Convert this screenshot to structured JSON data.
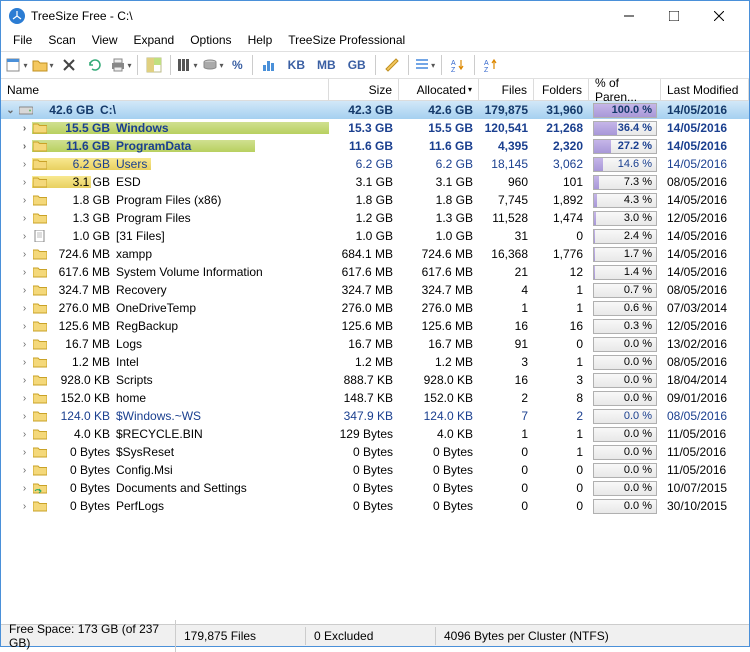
{
  "window": {
    "title": "TreeSize Free - C:\\"
  },
  "menu": [
    "File",
    "Scan",
    "View",
    "Expand",
    "Options",
    "Help",
    "TreeSize Professional"
  ],
  "toolbar": {
    "kb": "KB",
    "mb": "MB",
    "gb": "GB",
    "pct": "%"
  },
  "columns": {
    "name": "Name",
    "size": "Size",
    "alloc": "Allocated",
    "files": "Files",
    "folders": "Folders",
    "pct": "% of Paren...",
    "mod": "Last Modified"
  },
  "root": {
    "sizelabel": "42.6 GB",
    "name": "C:\\",
    "size": "42.3 GB",
    "alloc": "42.6 GB",
    "files": "179,875",
    "folders": "31,960",
    "pct": "100.0 %",
    "mod": "14/05/2016"
  },
  "rows": [
    {
      "indent": 1,
      "szw": 60,
      "sb": "green",
      "sbw": 100,
      "sizelabel": "15.5 GB",
      "name": "Windows",
      "size": "15.3 GB",
      "alloc": "15.5 GB",
      "files": "120,541",
      "folders": "21,268",
      "pct": "36.4 %",
      "pw": 36.4,
      "mod": "14/05/2016",
      "blue": true,
      "bold": true
    },
    {
      "indent": 1,
      "szw": 60,
      "sb": "green",
      "sbw": 75,
      "sizelabel": "11.6 GB",
      "name": "ProgramData",
      "size": "11.6 GB",
      "alloc": "11.6 GB",
      "files": "4,395",
      "folders": "2,320",
      "pct": "27.2 %",
      "pw": 27.2,
      "mod": "14/05/2016",
      "blue": true,
      "bold": true
    },
    {
      "indent": 1,
      "szw": 60,
      "sb": "yellow",
      "sbw": 40,
      "sizelabel": "6.2 GB",
      "name": "Users",
      "size": "6.2 GB",
      "alloc": "6.2 GB",
      "files": "18,145",
      "folders": "3,062",
      "pct": "14.6 %",
      "pw": 14.6,
      "mod": "14/05/2016",
      "blue": true
    },
    {
      "indent": 1,
      "szw": 60,
      "sb": "yellow",
      "sbw": 20,
      "sizelabel": "3.1 GB",
      "name": "ESD",
      "size": "3.1 GB",
      "alloc": "3.1 GB",
      "files": "960",
      "folders": "101",
      "pct": "7.3 %",
      "pw": 7.3,
      "mod": "08/05/2016"
    },
    {
      "indent": 1,
      "szw": 60,
      "sizelabel": "1.8 GB",
      "name": "Program Files (x86)",
      "size": "1.8 GB",
      "alloc": "1.8 GB",
      "files": "7,745",
      "folders": "1,892",
      "pct": "4.3 %",
      "pw": 4.3,
      "mod": "14/05/2016"
    },
    {
      "indent": 1,
      "szw": 60,
      "sizelabel": "1.3 GB",
      "name": "Program Files",
      "size": "1.2 GB",
      "alloc": "1.3 GB",
      "files": "11,528",
      "folders": "1,474",
      "pct": "3.0 %",
      "pw": 3.0,
      "mod": "12/05/2016"
    },
    {
      "indent": 1,
      "szw": 60,
      "sizelabel": "1.0 GB",
      "name": "[31 Files]",
      "size": "1.0 GB",
      "alloc": "1.0 GB",
      "files": "31",
      "folders": "0",
      "pct": "2.4 %",
      "pw": 2.4,
      "mod": "14/05/2016",
      "file": true
    },
    {
      "indent": 1,
      "szw": 60,
      "sizelabel": "724.6 MB",
      "name": "xampp",
      "size": "684.1 MB",
      "alloc": "724.6 MB",
      "files": "16,368",
      "folders": "1,776",
      "pct": "1.7 %",
      "pw": 1.7,
      "mod": "14/05/2016"
    },
    {
      "indent": 1,
      "szw": 60,
      "sizelabel": "617.6 MB",
      "name": "System Volume Information",
      "size": "617.6 MB",
      "alloc": "617.6 MB",
      "files": "21",
      "folders": "12",
      "pct": "1.4 %",
      "pw": 1.4,
      "mod": "14/05/2016"
    },
    {
      "indent": 1,
      "szw": 60,
      "sizelabel": "324.7 MB",
      "name": "Recovery",
      "size": "324.7 MB",
      "alloc": "324.7 MB",
      "files": "4",
      "folders": "1",
      "pct": "0.7 %",
      "pw": 0.7,
      "mod": "08/05/2016"
    },
    {
      "indent": 1,
      "szw": 60,
      "sizelabel": "276.0 MB",
      "name": "OneDriveTemp",
      "size": "276.0 MB",
      "alloc": "276.0 MB",
      "files": "1",
      "folders": "1",
      "pct": "0.6 %",
      "pw": 0.6,
      "mod": "07/03/2014"
    },
    {
      "indent": 1,
      "szw": 60,
      "sizelabel": "125.6 MB",
      "name": "RegBackup",
      "size": "125.6 MB",
      "alloc": "125.6 MB",
      "files": "16",
      "folders": "16",
      "pct": "0.3 %",
      "pw": 0.3,
      "mod": "12/05/2016"
    },
    {
      "indent": 1,
      "szw": 60,
      "sizelabel": "16.7 MB",
      "name": "Logs",
      "size": "16.7 MB",
      "alloc": "16.7 MB",
      "files": "91",
      "folders": "0",
      "pct": "0.0 %",
      "pw": 0,
      "mod": "13/02/2016"
    },
    {
      "indent": 1,
      "szw": 60,
      "sizelabel": "1.2 MB",
      "name": "Intel",
      "size": "1.2 MB",
      "alloc": "1.2 MB",
      "files": "3",
      "folders": "1",
      "pct": "0.0 %",
      "pw": 0,
      "mod": "08/05/2016"
    },
    {
      "indent": 1,
      "szw": 60,
      "sizelabel": "928.0 KB",
      "name": "Scripts",
      "size": "888.7 KB",
      "alloc": "928.0 KB",
      "files": "16",
      "folders": "3",
      "pct": "0.0 %",
      "pw": 0,
      "mod": "18/04/2014"
    },
    {
      "indent": 1,
      "szw": 60,
      "sizelabel": "152.0 KB",
      "name": "home",
      "size": "148.7 KB",
      "alloc": "152.0 KB",
      "files": "2",
      "folders": "8",
      "pct": "0.0 %",
      "pw": 0,
      "mod": "09/01/2016"
    },
    {
      "indent": 1,
      "szw": 60,
      "sizelabel": "124.0 KB",
      "name": "$Windows.~WS",
      "size": "347.9 KB",
      "alloc": "124.0 KB",
      "files": "7",
      "folders": "2",
      "pct": "0.0 %",
      "pw": 0,
      "mod": "08/05/2016",
      "blue": true
    },
    {
      "indent": 1,
      "szw": 60,
      "sizelabel": "4.0 KB",
      "name": "$RECYCLE.BIN",
      "size": "129 Bytes",
      "alloc": "4.0 KB",
      "files": "1",
      "folders": "1",
      "pct": "0.0 %",
      "pw": 0,
      "mod": "11/05/2016"
    },
    {
      "indent": 1,
      "szw": 60,
      "sizelabel": "0 Bytes",
      "name": "$SysReset",
      "size": "0 Bytes",
      "alloc": "0 Bytes",
      "files": "0",
      "folders": "1",
      "pct": "0.0 %",
      "pw": 0,
      "mod": "11/05/2016"
    },
    {
      "indent": 1,
      "szw": 60,
      "sizelabel": "0 Bytes",
      "name": "Config.Msi",
      "size": "0 Bytes",
      "alloc": "0 Bytes",
      "files": "0",
      "folders": "0",
      "pct": "0.0 %",
      "pw": 0,
      "mod": "11/05/2016"
    },
    {
      "indent": 1,
      "szw": 60,
      "sizelabel": "0 Bytes",
      "name": "Documents and Settings",
      "size": "0 Bytes",
      "alloc": "0 Bytes",
      "files": "0",
      "folders": "0",
      "pct": "0.0 %",
      "pw": 0,
      "mod": "10/07/2015",
      "link": true
    },
    {
      "indent": 1,
      "szw": 60,
      "sizelabel": "0 Bytes",
      "name": "PerfLogs",
      "size": "0 Bytes",
      "alloc": "0 Bytes",
      "files": "0",
      "folders": "0",
      "pct": "0.0 %",
      "pw": 0,
      "mod": "30/10/2015"
    }
  ],
  "status": {
    "free": "Free Space: 173 GB  (of 237 GB)",
    "files": "179,875  Files",
    "excl": "0 Excluded",
    "cluster": "4096  Bytes per Cluster (NTFS)"
  }
}
